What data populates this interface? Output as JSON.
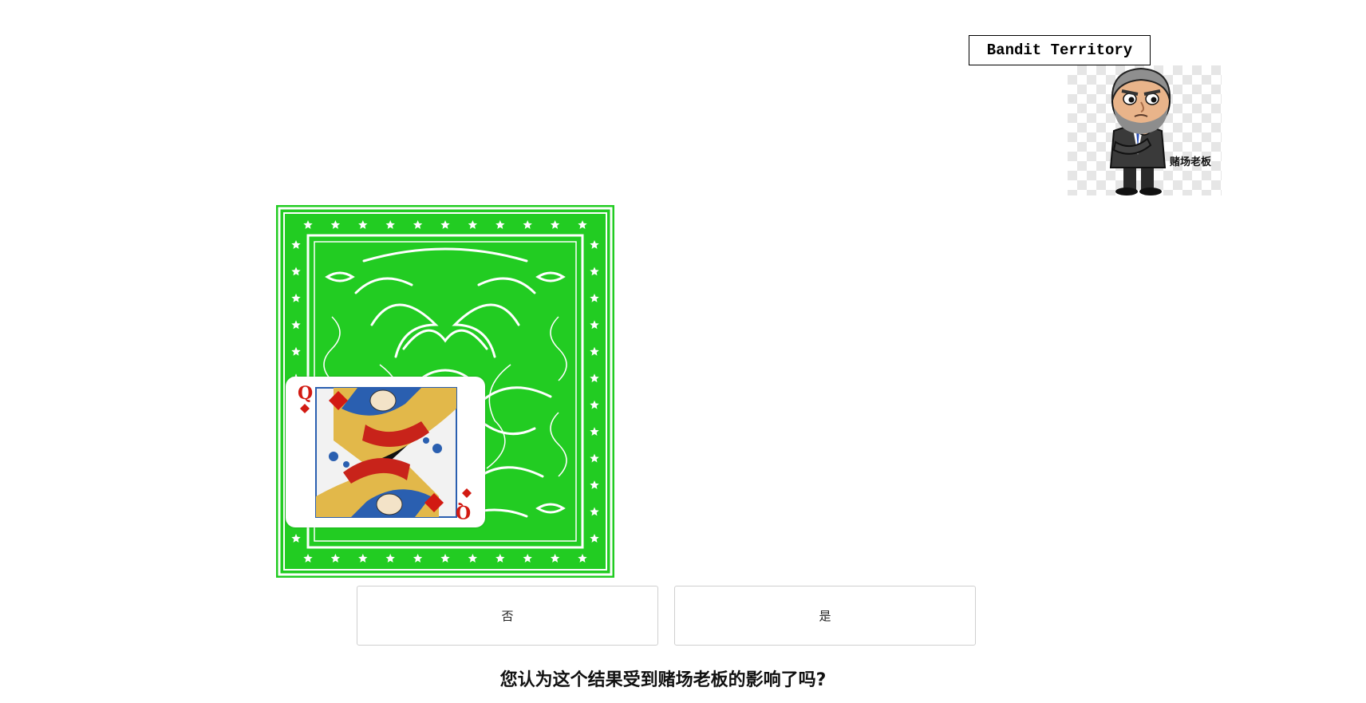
{
  "header": {
    "territory_label": "Bandit Territory"
  },
  "boss": {
    "caption": "赌场老板",
    "icon": "casino-boss-avatar"
  },
  "card": {
    "back_color": "#22cc22",
    "face_rank": "Q",
    "face_suit": "diamond",
    "suit_color": "#d21a12"
  },
  "answers": {
    "no_label": "否",
    "yes_label": "是"
  },
  "question": {
    "text": "您认为这个结果受到赌场老板的影响了吗?"
  }
}
